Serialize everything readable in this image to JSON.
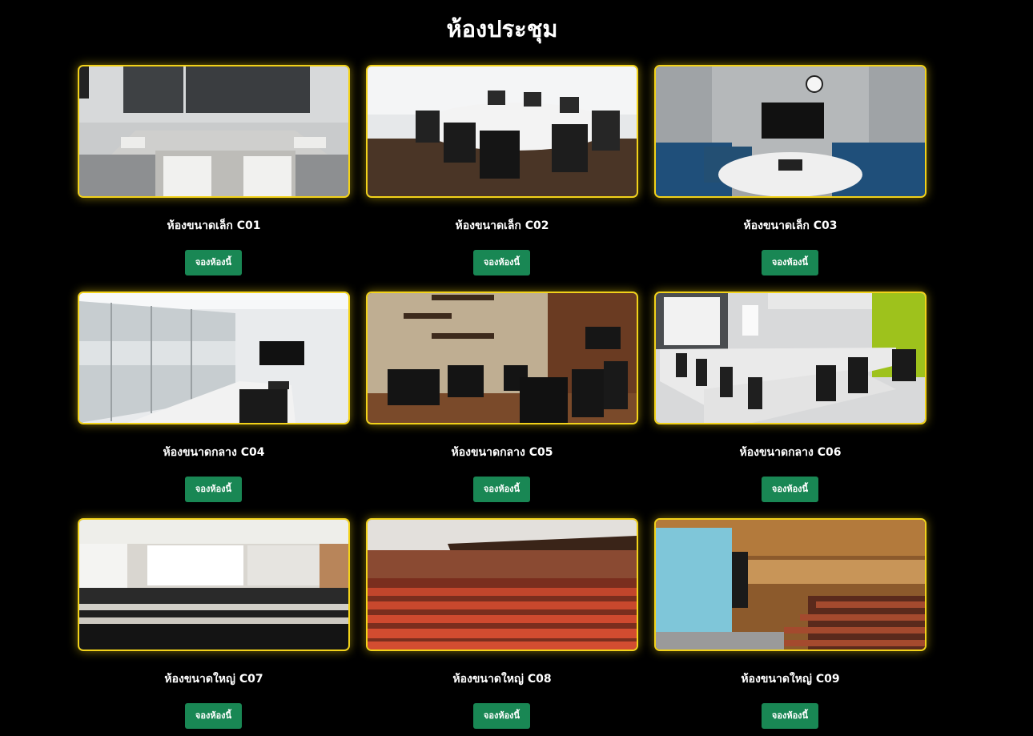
{
  "page": {
    "title": "ห้องประชุม"
  },
  "rooms": [
    {
      "name": "ห้องขนาดเล็ก C01",
      "button": "จองห้องนี้"
    },
    {
      "name": "ห้องขนาดเล็ก C02",
      "button": "จองห้องนี้"
    },
    {
      "name": "ห้องขนาดเล็ก C03",
      "button": "จองห้องนี้"
    },
    {
      "name": "ห้องขนาดกลาง C04",
      "button": "จองห้องนี้"
    },
    {
      "name": "ห้องขนาดกลาง C05",
      "button": "จองห้องนี้"
    },
    {
      "name": "ห้องขนาดกลาง C06",
      "button": "จองห้องนี้"
    },
    {
      "name": "ห้องขนาดใหญ่ C07",
      "button": "จองห้องนี้"
    },
    {
      "name": "ห้องขนาดใหญ่ C08",
      "button": "จองห้องนี้"
    },
    {
      "name": "ห้องขนาดใหญ่ C09",
      "button": "จองห้องนี้"
    }
  ],
  "colors": {
    "background": "#000000",
    "card_border": "#f2d21a",
    "button": "#198754",
    "text": "#ffffff"
  }
}
